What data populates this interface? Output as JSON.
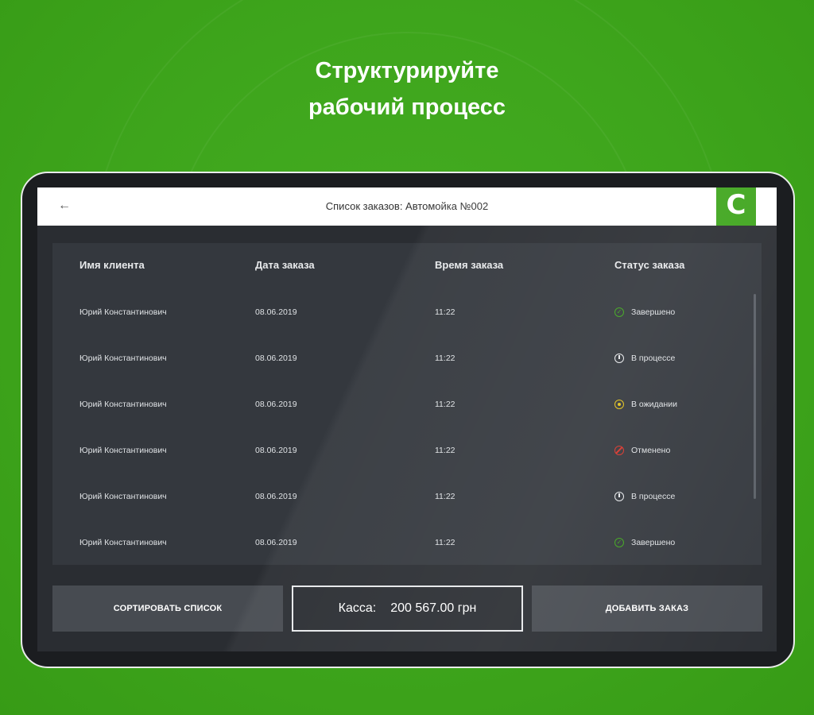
{
  "headline": {
    "line1": "Структурируйте",
    "line2": "рабочий процесс"
  },
  "topbar": {
    "title": "Список заказов: Автомойка №002",
    "logo_letter": "C"
  },
  "table": {
    "headers": {
      "client": "Имя клиента",
      "date": "Дата заказа",
      "time": "Время заказа",
      "status": "Статус заказа"
    },
    "rows": [
      {
        "client": "Юрий Константинович",
        "date": "08.06.2019",
        "time": "11:22",
        "status": "Завершено",
        "status_icon": "check-circle-icon"
      },
      {
        "client": "Юрий Константинович",
        "date": "08.06.2019",
        "time": "11:22",
        "status": "В процессе",
        "status_icon": "power-icon"
      },
      {
        "client": "Юрий Константинович",
        "date": "08.06.2019",
        "time": "11:22",
        "status": "В ожидании",
        "status_icon": "pause-circle-icon"
      },
      {
        "client": "Юрий Константинович",
        "date": "08.06.2019",
        "time": "11:22",
        "status": "Отменено",
        "status_icon": "cancel-circle-icon"
      },
      {
        "client": "Юрий Константинович",
        "date": "08.06.2019",
        "time": "11:22",
        "status": "В процессе",
        "status_icon": "power-icon"
      },
      {
        "client": "Юрий Константинович",
        "date": "08.06.2019",
        "time": "11:22",
        "status": "Завершено",
        "status_icon": "check-circle-icon"
      }
    ]
  },
  "footer": {
    "sort_label": "СОРТИРОВАТЬ СПИСОК",
    "cash_label": "Касса:",
    "cash_value": "200 567.00 грн",
    "add_label": "ДОБАВИТЬ ЗАКАЗ"
  },
  "colors": {
    "brand_green": "#3ea51c",
    "done": "#3ea51c",
    "waiting": "#e3c21a",
    "cancelled": "#d9342b",
    "in_process": "#e8eaec"
  }
}
